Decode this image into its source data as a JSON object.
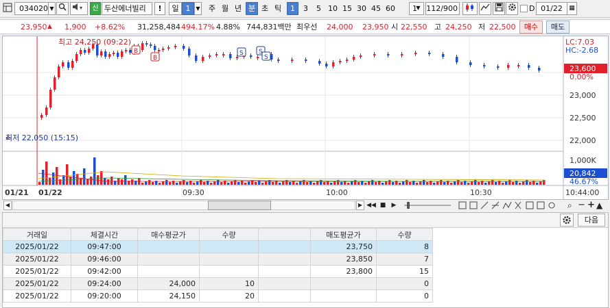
{
  "toolbar": {
    "stock_code": "034020",
    "signal_label": "신",
    "stock_name": "두산에너빌리",
    "warning_label": "!",
    "period_day": "일",
    "period_num": "1",
    "period_week": "주",
    "period_month": "월",
    "period_year": "년",
    "period_minute": "분",
    "period_second": "초",
    "period_tick": "틱",
    "intervals": [
      "1",
      "3",
      "5",
      "10",
      "15",
      "30",
      "45",
      "60"
    ],
    "interval_select": "1",
    "count_display": "112",
    "count_total": "/900",
    "date_check_label": "D",
    "date_value": "01/22"
  },
  "quote": {
    "price": "23,950",
    "change": "1,900",
    "change_pct": "+8.62%",
    "volume": "31,258,484",
    "volume_ratio": "494.17%",
    "turnover": "4.88%",
    "amount": "744,831백만",
    "best_label": "최우선",
    "best_ask": "24,000",
    "best_bid": "23,950",
    "open_label": "시",
    "open": "22,550",
    "high_label": "고",
    "high": "24,250",
    "low_label": "저",
    "low": "22,500",
    "buy_button": "매수",
    "sell_button": "매도"
  },
  "chart": {
    "high_annotation": "최고 24,250 (09:22)",
    "low_annotation": "최저 22,050 (15:15)",
    "lc_label": "LC:7.03",
    "hc_label": "HC:-2.68",
    "current_price_tag": "23,600",
    "current_pct": "0.00%",
    "volume_axis_label": "1,000K",
    "volume_tag": "20,842",
    "volume_pct": "46.67%",
    "date_left": "01/21",
    "date_main": "01/22",
    "time_labels": [
      "09:30",
      "10:00",
      "10:30"
    ],
    "end_time": "10:44:00",
    "colors": {
      "up": "#e0202a",
      "down": "#1c4fd0",
      "price_tag": "#e0202a",
      "volume_tag": "#1c4fd0"
    }
  },
  "chart_data": {
    "type": "candlestick",
    "y_ticks": [
      "23,500",
      "23,000",
      "22,500",
      "22,000"
    ],
    "ylim": [
      21900,
      24300
    ],
    "volume_ylim": [
      0,
      1000
    ],
    "volume_unit": "K"
  },
  "table": {
    "next_button": "다음",
    "headers": [
      "거래일",
      "체결시간",
      "매수평균가",
      "수량",
      "",
      "매도평균가",
      "수량"
    ],
    "rows": [
      [
        "2025/01/22",
        "09:47:00",
        "",
        "",
        "",
        "23,750",
        "8"
      ],
      [
        "2025/01/22",
        "09:46:00",
        "",
        "",
        "",
        "23,850",
        "7"
      ],
      [
        "2025/01/22",
        "09:42:00",
        "",
        "",
        "",
        "23,800",
        "15"
      ],
      [
        "2025/01/22",
        "09:24:00",
        "24,000",
        "10",
        "",
        "",
        "0"
      ],
      [
        "2025/01/22",
        "09:20:00",
        "24,150",
        "20",
        "",
        "",
        "0"
      ]
    ]
  }
}
